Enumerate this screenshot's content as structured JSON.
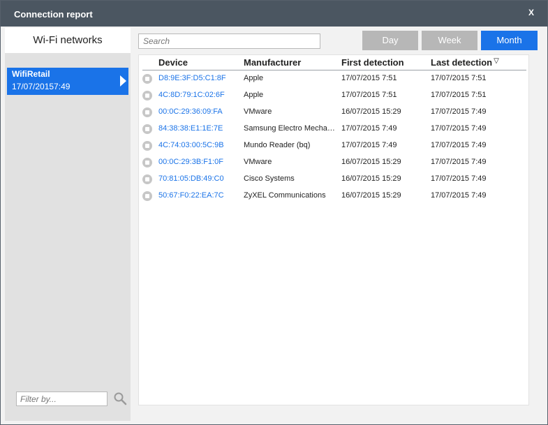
{
  "window": {
    "title": "Connection report",
    "close_label": "X"
  },
  "sidebar": {
    "header": "Wi-Fi networks",
    "networks": [
      {
        "name": "WifiRetail",
        "time": "17/07/20157:49"
      }
    ],
    "filter_placeholder": "Filter by..."
  },
  "main": {
    "search_placeholder": "Search",
    "range_buttons": {
      "day": "Day",
      "week": "Week",
      "month": "Month",
      "selected": "Month"
    },
    "table": {
      "columns": {
        "device": "Device",
        "manufacturer": "Manufacturer",
        "first": "First detection",
        "last": "Last detection"
      },
      "sort": {
        "column": "last",
        "direction": "descending"
      },
      "rows": [
        {
          "device": "D8:9E:3F:D5:C1:8F",
          "manufacturer": "Apple",
          "first": "17/07/2015 7:51",
          "last": "17/07/2015 7:51"
        },
        {
          "device": "4C:8D:79:1C:02:6F",
          "manufacturer": "Apple",
          "first": "17/07/2015 7:51",
          "last": "17/07/2015 7:51"
        },
        {
          "device": "00:0C:29:36:09:FA",
          "manufacturer": "VMware",
          "first": "16/07/2015 15:29",
          "last": "17/07/2015 7:49"
        },
        {
          "device": "84:38:38:E1:1E:7E",
          "manufacturer": "Samsung Electro Mechanics",
          "first": "17/07/2015 7:49",
          "last": "17/07/2015 7:49"
        },
        {
          "device": "4C:74:03:00:5C:9B",
          "manufacturer": "Mundo Reader (bq)",
          "first": "17/07/2015 7:49",
          "last": "17/07/2015 7:49"
        },
        {
          "device": "00:0C:29:3B:F1:0F",
          "manufacturer": "VMware",
          "first": "16/07/2015 15:29",
          "last": "17/07/2015 7:49"
        },
        {
          "device": "70:81:05:DB:49:C0",
          "manufacturer": "Cisco Systems",
          "first": "16/07/2015 15:29",
          "last": "17/07/2015 7:49"
        },
        {
          "device": "50:67:F0:22:EA:7C",
          "manufacturer": "ZyXEL Communications",
          "first": "16/07/2015 15:29",
          "last": "17/07/2015 7:49"
        }
      ]
    }
  },
  "colors": {
    "titlebar": "#4b5661",
    "accent": "#1a73e8",
    "button_inactive": "#b7b7b7",
    "sidebar_bg": "#e1e1e1"
  },
  "icons": {
    "row_icon": "lock-icon",
    "filter_icon": "search-icon",
    "sort_icon": "sort-descending-icon"
  }
}
